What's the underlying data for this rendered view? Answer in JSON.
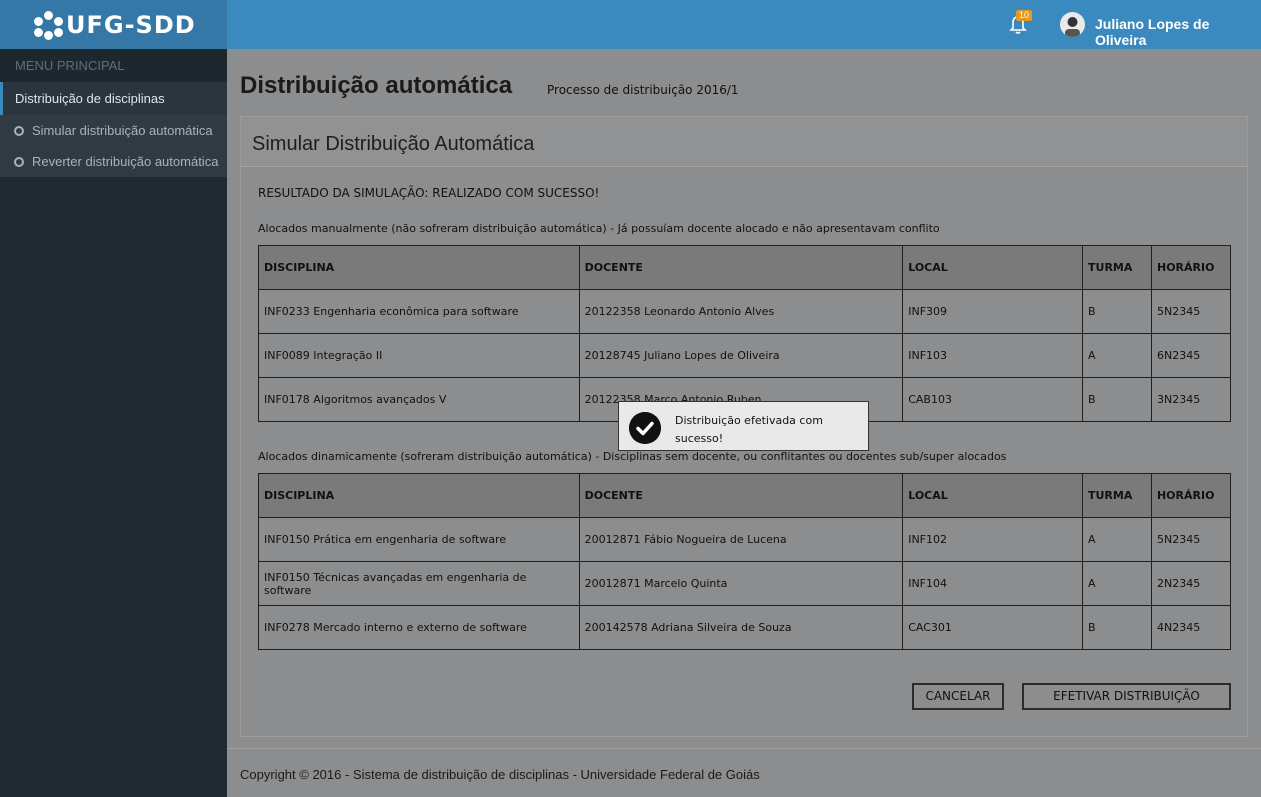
{
  "header": {
    "brand": "UFG-SDD",
    "notification_count": "10",
    "user_name": "Juliano Lopes de Oliveira"
  },
  "sidebar": {
    "heading": "MENU PRINCIPAL",
    "items": [
      {
        "label": "Distribuição de disciplinas"
      },
      {
        "label": "Simular distribuição automática"
      },
      {
        "label": "Reverter distribuição automática"
      }
    ]
  },
  "page": {
    "title": "Distribuição automática",
    "process_label": "Processo de distribuição 2016/1",
    "panel_title": "Simular Distribuição Automática",
    "result": "RESULTADO DA SIMULAÇÃO: REALIZADO COM SUCESSO!",
    "manual_desc": "Alocados manualmente (não sofreram distribuição automática) - Já possuíam docente alocado e não apresentavam conflito",
    "dynamic_desc": "Alocados dinamicamente (sofreram distribuição automática) - Disciplinas sem docente, ou conflitantes ou docentes sub/super alocados",
    "columns": [
      "DISCIPLINA",
      "DOCENTE",
      "LOCAL",
      "TURMA",
      "HORÁRIO"
    ],
    "manual_rows": [
      [
        "INF0233 Engenharia econômica para software",
        "20122358 Leonardo Antonio Alves",
        "INF309",
        "B",
        "5N2345"
      ],
      [
        "INF0089 Integração II",
        "20128745 Juliano Lopes de Oliveira",
        "INF103",
        "A",
        "6N2345"
      ],
      [
        "INF0178 Algoritmos avançados V",
        "20122358 Marco Antonio Ruben",
        "CAB103",
        "B",
        "3N2345"
      ]
    ],
    "dynamic_rows": [
      [
        "INF0150 Prática em engenharia de software",
        "20012871 Fábio Nogueira de Lucena",
        "INF102",
        "A",
        "5N2345"
      ],
      [
        "INF0150 Técnicas avançadas em engenharia de software",
        "20012871 Marcelo Quinta",
        "INF104",
        "A",
        "2N2345"
      ],
      [
        "INF0278 Mercado interno e externo de software",
        "200142578 Adriana Silveira de Souza",
        "CAC301",
        "B",
        "4N2345"
      ]
    ],
    "cancel_label": "CANCELAR",
    "confirm_label": "EFETIVAR DISTRIBUIÇÃO"
  },
  "toast": {
    "message": "Distribuição efetivada com sucesso!"
  },
  "footer": {
    "text": "Copyright © 2016 - Sistema de distribuição de disciplinas - Universidade Federal de Goiás"
  },
  "colors": {
    "topbar": "#3a8abf",
    "brand_bg": "#3578a8",
    "sidebar_bg": "#212a31",
    "overlay_bg": "#8c8d8e",
    "badge": "#e69a1d"
  }
}
